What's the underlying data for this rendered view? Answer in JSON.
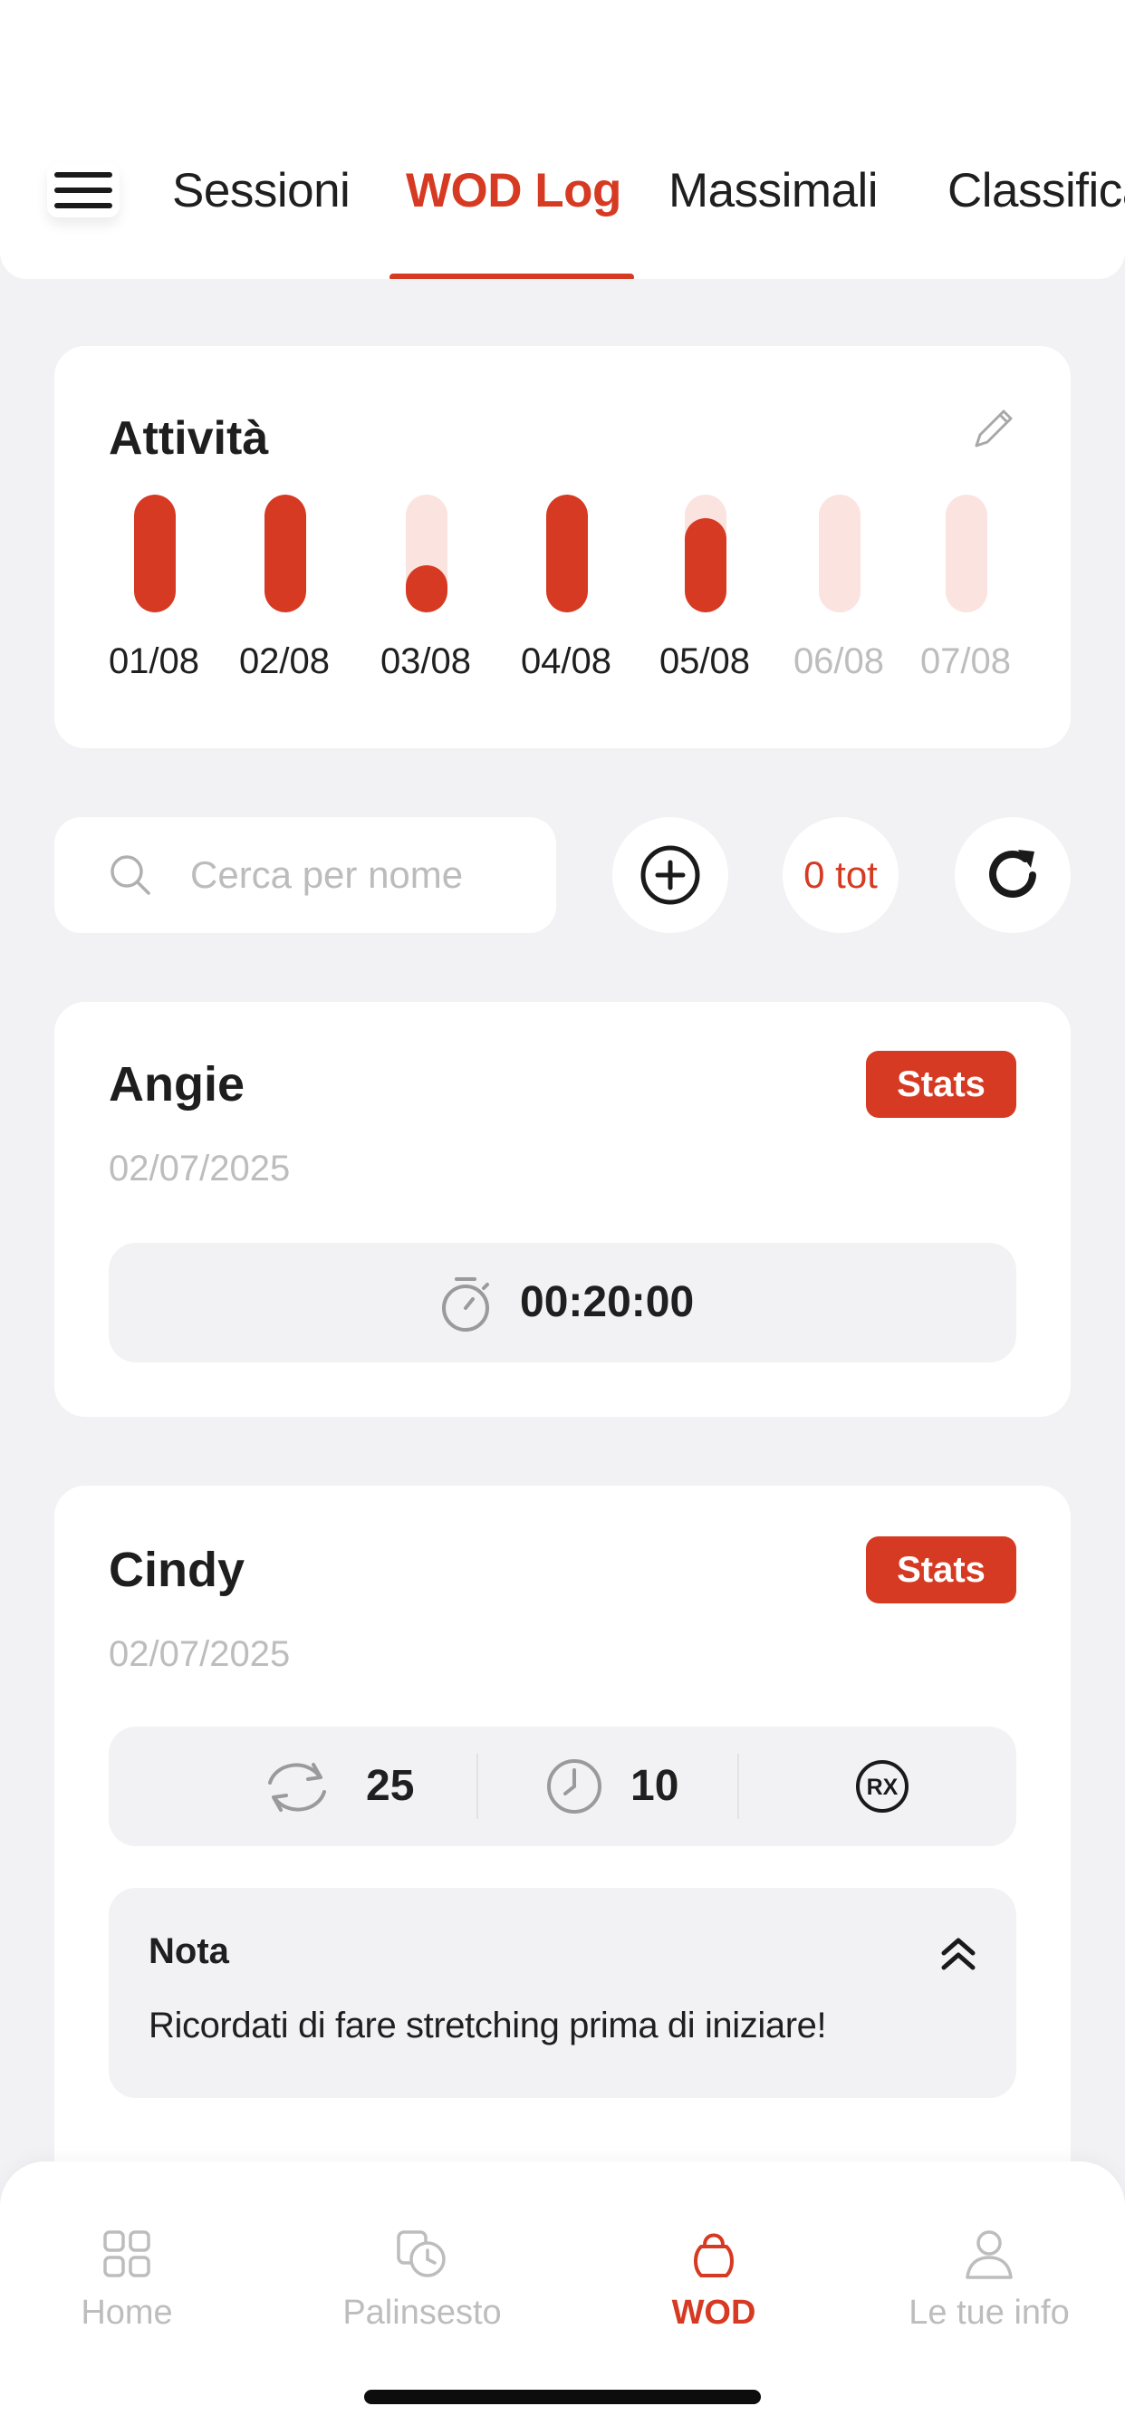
{
  "tabs": [
    {
      "label": "Sessioni"
    },
    {
      "label": "WOD Log"
    },
    {
      "label": "Massimali"
    },
    {
      "label": "Classifica"
    }
  ],
  "activity": {
    "title": "Attività",
    "days": [
      {
        "label": "01/08",
        "fill": 1.0,
        "future": false
      },
      {
        "label": "02/08",
        "fill": 1.0,
        "future": false
      },
      {
        "label": "03/08",
        "fill": 0.4,
        "future": false
      },
      {
        "label": "04/08",
        "fill": 1.0,
        "future": false
      },
      {
        "label": "05/08",
        "fill": 0.8,
        "future": false
      },
      {
        "label": "06/08",
        "fill": 0.0,
        "future": true
      },
      {
        "label": "07/08",
        "fill": 0.0,
        "future": true
      }
    ]
  },
  "search": {
    "placeholder": "Cerca per nome"
  },
  "total_label": "0 tot",
  "wods": [
    {
      "name": "Angie",
      "date": "02/07/2025",
      "stats_label": "Stats",
      "time": "00:20:00"
    },
    {
      "name": "Cindy",
      "date": "02/07/2025",
      "stats_label": "Stats",
      "rounds": "25",
      "minutes": "10",
      "rx_label": "RX",
      "note": {
        "title": "Nota",
        "text": "Ricordati di fare stretching prima di iniziare!"
      }
    }
  ],
  "bottom_nav": [
    {
      "label": "Home",
      "icon": "grid-icon"
    },
    {
      "label": "Palinsesto",
      "icon": "schedule-icon"
    },
    {
      "label": "WOD",
      "icon": "kettlebell-icon"
    },
    {
      "label": "Le tue info",
      "icon": "user-icon"
    }
  ],
  "colors": {
    "accent": "#d63a22",
    "accent_light": "#fbe3df",
    "background": "#f2f2f5",
    "muted": "#bdbdbd"
  }
}
